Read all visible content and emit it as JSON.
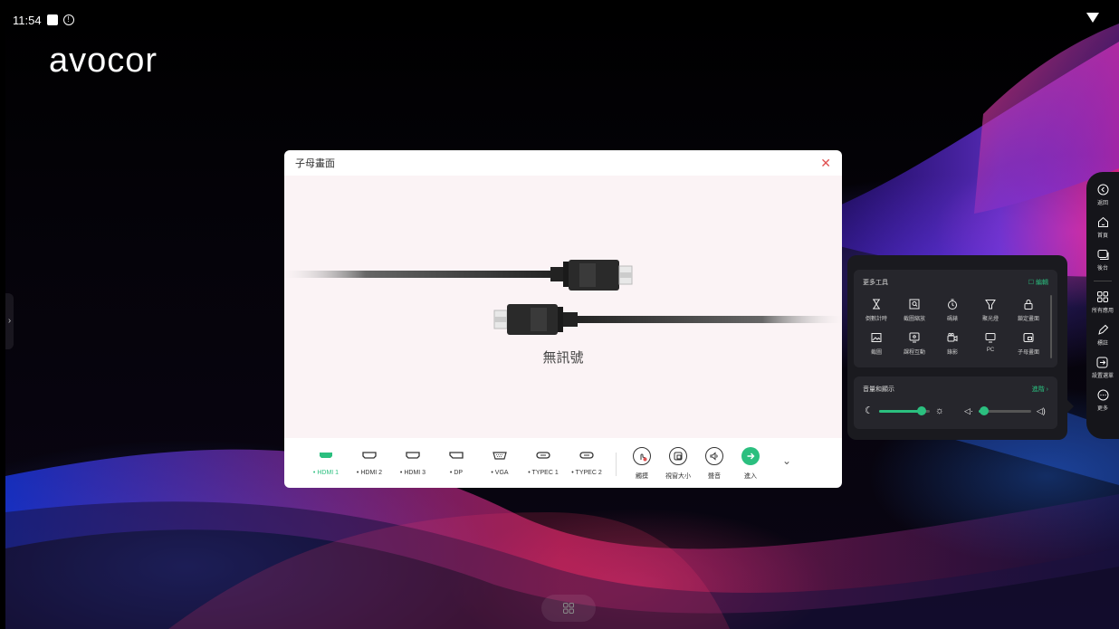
{
  "status_bar": {
    "time": "11:54"
  },
  "brand": {
    "logo": "avocor"
  },
  "dialog": {
    "title": "子母畫面",
    "close_icon": "close-icon",
    "no_signal": "無訊號",
    "sources": [
      {
        "label": "HDMI 1",
        "icon": "hdmi-icon",
        "active": true
      },
      {
        "label": "HDMI 2",
        "icon": "hdmi-icon",
        "active": false
      },
      {
        "label": "HDMI 3",
        "icon": "hdmi-icon",
        "active": false
      },
      {
        "label": "DP",
        "icon": "displayport-icon",
        "active": false
      },
      {
        "label": "VGA",
        "icon": "vga-icon",
        "active": false
      },
      {
        "label": "TYPEC 1",
        "icon": "usb-c-icon",
        "active": false
      },
      {
        "label": "TYPEC 2",
        "icon": "usb-c-icon",
        "active": false
      }
    ],
    "actions": [
      {
        "label": "觸摸",
        "icon": "touch-icon"
      },
      {
        "label": "視窗大小",
        "icon": "window-size-icon"
      },
      {
        "label": "聲音",
        "icon": "speaker-icon"
      },
      {
        "label": "進入",
        "icon": "enter-arrow-icon"
      }
    ]
  },
  "sidebar": {
    "items": [
      {
        "label": "返回",
        "icon": "back-icon"
      },
      {
        "label": "首頁",
        "icon": "home-icon"
      },
      {
        "label": "後台",
        "icon": "recent-apps-icon"
      },
      {
        "label": "所有應用",
        "icon": "all-apps-icon"
      },
      {
        "label": "標註",
        "icon": "pen-icon"
      },
      {
        "label": "設置選單",
        "icon": "settings-menu-icon"
      },
      {
        "label": "更多",
        "icon": "more-icon"
      }
    ]
  },
  "tools_panel": {
    "more_tools_title": "更多工具",
    "edit_label": "編輯",
    "tools": [
      {
        "label": "倒數計時",
        "icon": "hourglass-icon"
      },
      {
        "label": "截圖縮放",
        "icon": "zoom-capture-icon"
      },
      {
        "label": "碼錶",
        "icon": "stopwatch-icon"
      },
      {
        "label": "聚光燈",
        "icon": "spotlight-icon"
      },
      {
        "label": "鎖定畫面",
        "icon": "lock-icon"
      },
      {
        "label": "截圖",
        "icon": "screenshot-icon"
      },
      {
        "label": "課程互動",
        "icon": "classroom-icon"
      },
      {
        "label": "錄影",
        "icon": "record-icon"
      },
      {
        "label": "PC",
        "icon": "monitor-icon"
      },
      {
        "label": "子母畫面",
        "icon": "pip-icon"
      }
    ],
    "audio_display_title": "音量和顯示",
    "advanced_label": "進階 ›",
    "brightness_level": 0.85,
    "volume_level": 0.1
  },
  "colors": {
    "accent": "#2bbf7f",
    "close": "#e05050"
  }
}
